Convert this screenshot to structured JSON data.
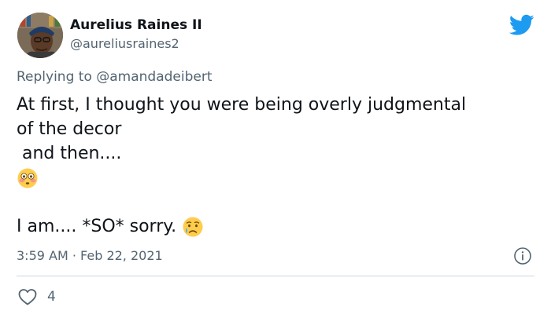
{
  "tweet": {
    "author": {
      "display_name": "Aurelius Raines II",
      "handle": "@aureliusraines2"
    },
    "replying_prefix": "Replying to ",
    "replying_to": "@amandadeibert",
    "lines": [
      "At first, I thought you were being overly judgmental",
      "of the decor",
      " and then....",
      "I am.... *SO* sorry."
    ],
    "emojis": [
      "flushed-face-emoji",
      "sad-relieved-face-emoji"
    ],
    "timestamp": "3:59 AM · Feb 22, 2021",
    "like_count": "4",
    "icons": [
      "twitter-bird-icon",
      "info-icon",
      "heart-icon"
    ]
  },
  "colors": {
    "twitter_blue": "#1d9bf0",
    "secondary_text": "#536471",
    "divider": "#cfd9de"
  }
}
